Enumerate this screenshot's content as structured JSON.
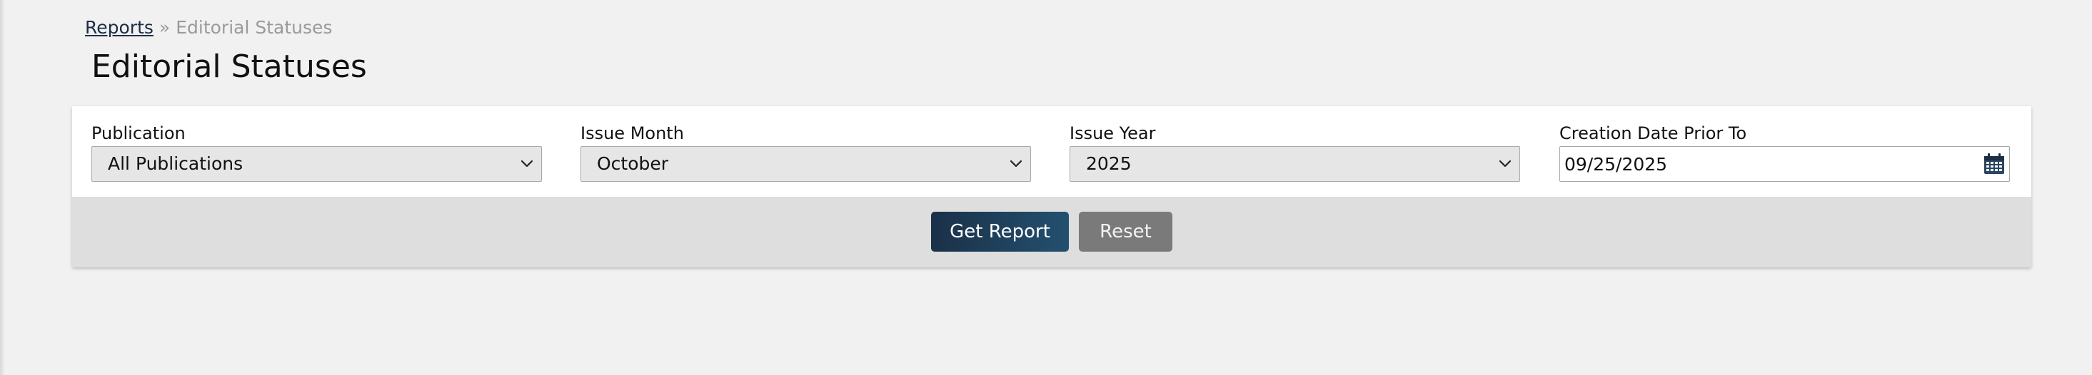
{
  "breadcrumb": {
    "parent_label": "Reports",
    "separator": "»",
    "current_label": "Editorial Statuses"
  },
  "page": {
    "title": "Editorial Statuses"
  },
  "filters": {
    "publication": {
      "label": "Publication",
      "selected": "All Publications",
      "icon": "chevron-down-icon"
    },
    "issue_month": {
      "label": "Issue Month",
      "selected": "October",
      "icon": "chevron-down-icon"
    },
    "issue_year": {
      "label": "Issue Year",
      "selected": "2025",
      "icon": "chevron-down-icon"
    },
    "creation_date": {
      "label": "Creation Date Prior To",
      "value": "09/25/2025",
      "icon": "calendar-icon"
    }
  },
  "actions": {
    "get_report_label": "Get Report",
    "reset_label": "Reset"
  },
  "colors": {
    "page_background": "#f1f1f1",
    "panel_background": "#ffffff",
    "action_bar_background": "#dedede",
    "primary_button": "#1f4260",
    "reset_button": "#7a7a7a",
    "link": "#1c2e45",
    "muted_text": "#9a9a9a"
  }
}
